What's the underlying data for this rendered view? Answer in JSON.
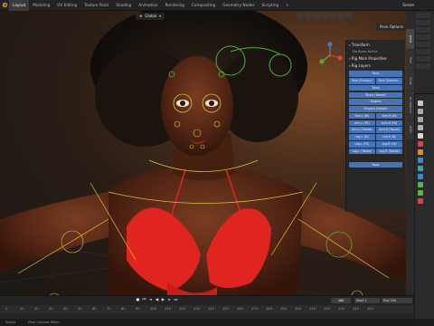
{
  "topbar": {
    "tabs": [
      "Layout",
      "Modeling",
      "UV Editing",
      "Texture Paint",
      "Shading",
      "Animation",
      "Rendering",
      "Compositing",
      "Geometry Nodes",
      "Scripting",
      "+"
    ],
    "active_tab": 0,
    "scene": "Scene"
  },
  "viewport": {
    "mode": "Global",
    "pose_options": "Pose Options"
  },
  "npanel": {
    "transform_label": "Transform",
    "no_bone": "No Bone Active",
    "rig_main_label": "Rig Main Properties",
    "rig_layers_label": "Rig Layers",
    "buttons": [
      [
        "Face"
      ],
      [
        "Face (Primary)",
        "Face (Second..."
      ],
      [
        "Torso"
      ],
      [
        "Torso (Tweak)"
      ],
      [
        "Fingers"
      ],
      [
        "Fingers (Detail)"
      ],
      [
        "Arm.L (IK)",
        "Arm.R (IK)"
      ],
      [
        "Arm.L (FK)",
        "Arm.R (FK)"
      ],
      [
        "Arm.L (Tweak)",
        "Arm.R (Tweak)"
      ],
      [
        "Leg.L (IK)",
        "Leg.R (IK)"
      ],
      [
        "Leg.L (FK)",
        "Leg.R (FK)"
      ],
      [
        "Leg.L (Tweak)",
        "Leg.R (Tweak)"
      ]
    ],
    "root": "Root"
  },
  "vtabs": [
    "Item",
    "Tool",
    "View",
    "Animation",
    "AIRY"
  ],
  "timeline": {
    "current_frame": "466",
    "start": "Start",
    "start_val": "1",
    "end": "End",
    "end_val": "250",
    "ruler": [
      "0",
      "10",
      "20",
      "30",
      "40",
      "50",
      "60",
      "70",
      "80",
      "90",
      "100",
      "110",
      "120",
      "130",
      "140",
      "150",
      "160",
      "170",
      "180",
      "190",
      "200",
      "210",
      "220",
      "230",
      "240",
      "250"
    ]
  },
  "statusbar": {
    "left": "Select",
    "mid": "Pose Context Menu"
  },
  "colors": {
    "accent": "#4772b3",
    "swimsuit": "#e0241f",
    "rig_yellow": "#d8c23a",
    "rig_green": "#4fae3e"
  }
}
